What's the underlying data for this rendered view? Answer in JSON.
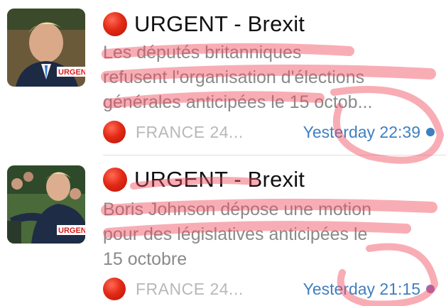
{
  "notifications": [
    {
      "title": "URGENT - Brexit",
      "body_lines": [
        "Les députés britanniques",
        "refusent l'organisation d'élections",
        "générales anticipées le 15 octob..."
      ],
      "source": "FRANCE 24...",
      "time": "Yesterday 22:39",
      "thumb_caption": "URGEN",
      "unread": true
    },
    {
      "title": "URGENT - Brexit",
      "body_lines": [
        "Boris Johnson dépose une motion",
        "pour des législatives anticipées le",
        "15 octobre"
      ],
      "source": "FRANCE 24...",
      "time": "Yesterday 21:15",
      "thumb_caption": "URGEN",
      "unread": true
    }
  ],
  "colors": {
    "accent_blue": "#3f7fbf",
    "urgent_red": "#e32a15",
    "highlighter": "#f04a5a"
  },
  "icons": [
    "red-circle-icon",
    "unread-dot-icon"
  ]
}
